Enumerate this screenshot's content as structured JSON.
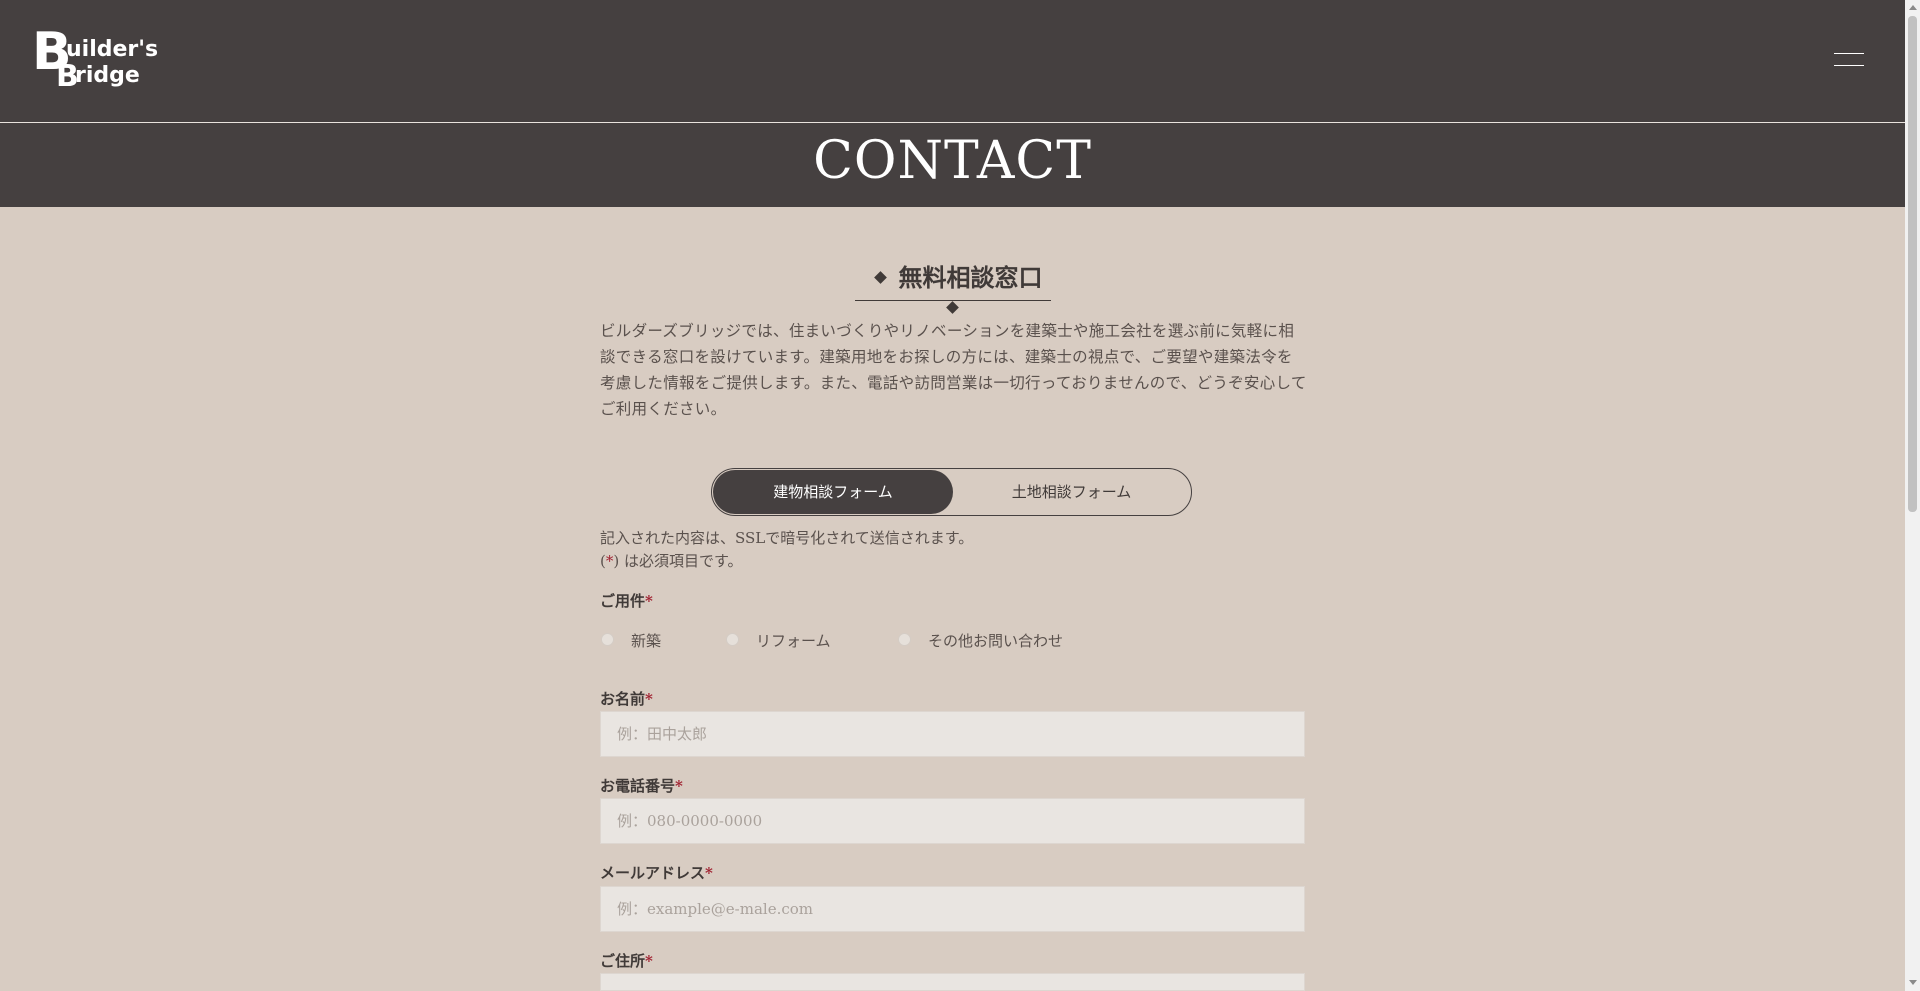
{
  "header": {
    "logo": {
      "line1_initial": "B",
      "line1_rest": "uilder's",
      "line2_initial": "B",
      "line2_rest": "ridge"
    },
    "menu_icon": "hamburger-menu-icon"
  },
  "page_title": "CONTACT",
  "section": {
    "heading": "無料相談窓口",
    "intro": "ビルダーズブリッジでは、住まいづくりやリノベーションを建築士や施工会社を選ぶ前に気軽に相談できる窓口を設けています。建築用地をお探しの方には、建築士の視点で、ご要望や建築法令を考慮した情報をご提供します。また、電話や訪問営業は一切行っておりませんので、どうぞ安心してご利用ください。"
  },
  "tabs": [
    {
      "label": "建物相談フォーム",
      "active": true
    },
    {
      "label": "土地相談フォーム",
      "active": false
    }
  ],
  "notes": {
    "ssl": "記入された内容は、SSLで暗号化されて送信されます。",
    "required_open": "(",
    "required_mark": "*",
    "required_rest": ") は必須項目です。"
  },
  "form": {
    "required_mark": "*",
    "inquiry": {
      "label": "ご用件",
      "options": [
        "新築",
        "リフォーム",
        "その他お問い合わせ"
      ]
    },
    "name": {
      "label": "お名前",
      "placeholder": "例：田中太郎",
      "value": ""
    },
    "phone": {
      "label": "お電話番号",
      "placeholder": "例：080-0000-0000",
      "value": ""
    },
    "email": {
      "label": "メールアドレス",
      "placeholder": "例：example@e-male.com",
      "value": ""
    },
    "address": {
      "label": "ご住所",
      "placeholder": "",
      "value": ""
    }
  },
  "colors": {
    "header_bg": "#454040",
    "page_bg": "#d8ccc2",
    "required": "#a02030"
  }
}
